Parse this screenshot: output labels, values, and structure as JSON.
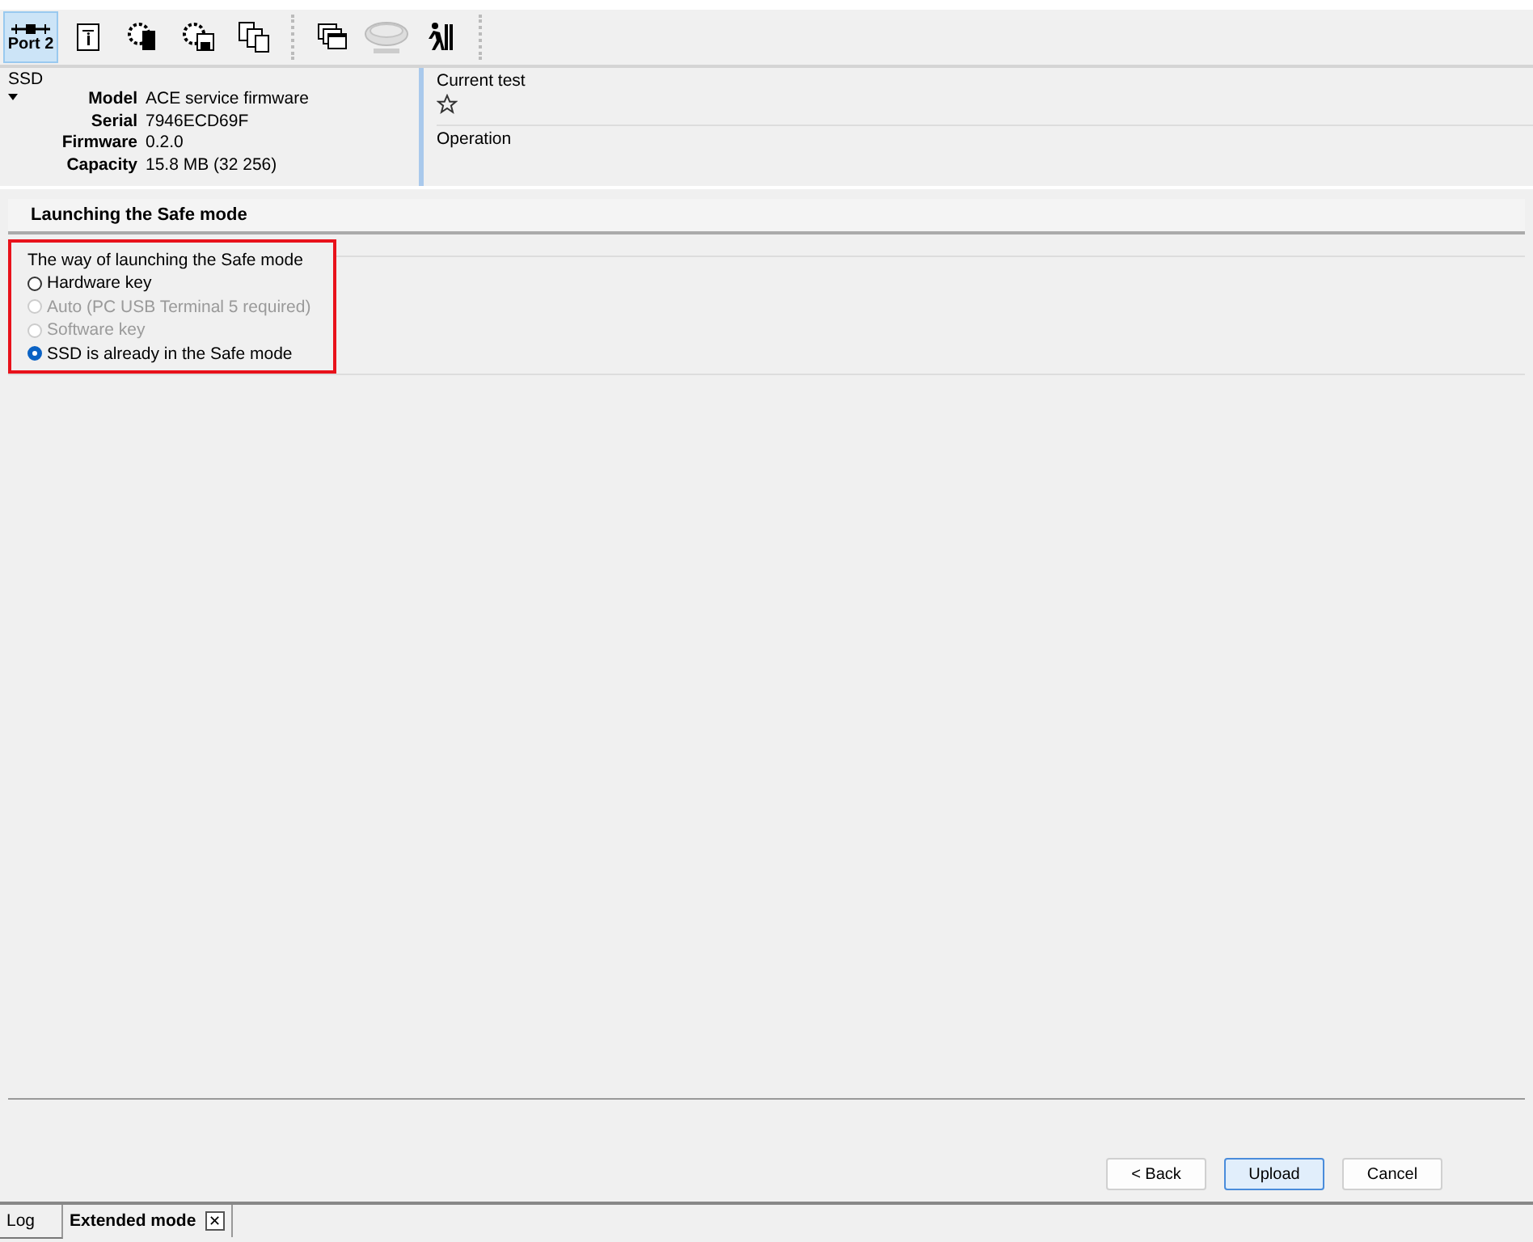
{
  "toolbar": {
    "port_label": "Port 2",
    "port_selected": true,
    "tools": [
      {
        "kind": "info",
        "disabled": false
      },
      {
        "kind": "chip-gear",
        "disabled": false
      },
      {
        "kind": "disk-gear",
        "disabled": false
      },
      {
        "kind": "pages",
        "disabled": false
      },
      {
        "kind": "windows",
        "disabled": false
      },
      {
        "kind": "drive",
        "disabled": true
      },
      {
        "kind": "runner",
        "disabled": false
      }
    ]
  },
  "drive_info": {
    "title": "SSD",
    "fields": [
      {
        "label": "Model",
        "value": "ACE service firmware"
      },
      {
        "label": "Serial",
        "value": "7946ECD69F"
      },
      {
        "label": "Firmware",
        "value": "0.2.0"
      },
      {
        "label": "Capacity",
        "value": "15.8 MB (32 256)"
      }
    ]
  },
  "current_test": {
    "title": "Current test",
    "favorite": false
  },
  "operation": {
    "title": "Operation"
  },
  "section_title": "Launching the Safe mode",
  "launch_group": {
    "title": "The way of launching the Safe mode",
    "highlighted": true,
    "options": [
      {
        "label": "Hardware key",
        "selected": false,
        "disabled": false
      },
      {
        "label": "Auto (PC USB Terminal 5 required)",
        "selected": false,
        "disabled": true
      },
      {
        "label": "Software key",
        "selected": false,
        "disabled": true
      },
      {
        "label": "SSD is already in the Safe mode",
        "selected": true,
        "disabled": false
      }
    ]
  },
  "buttons": [
    {
      "label": "< Back",
      "default": false
    },
    {
      "label": "Upload",
      "default": true
    },
    {
      "label": "Cancel",
      "default": false
    }
  ],
  "bottom_tabs": [
    {
      "label": "Log",
      "selected": false,
      "closable": false
    },
    {
      "label": "Extended mode",
      "selected": true,
      "closable": true,
      "close_glyph": "✕"
    }
  ]
}
